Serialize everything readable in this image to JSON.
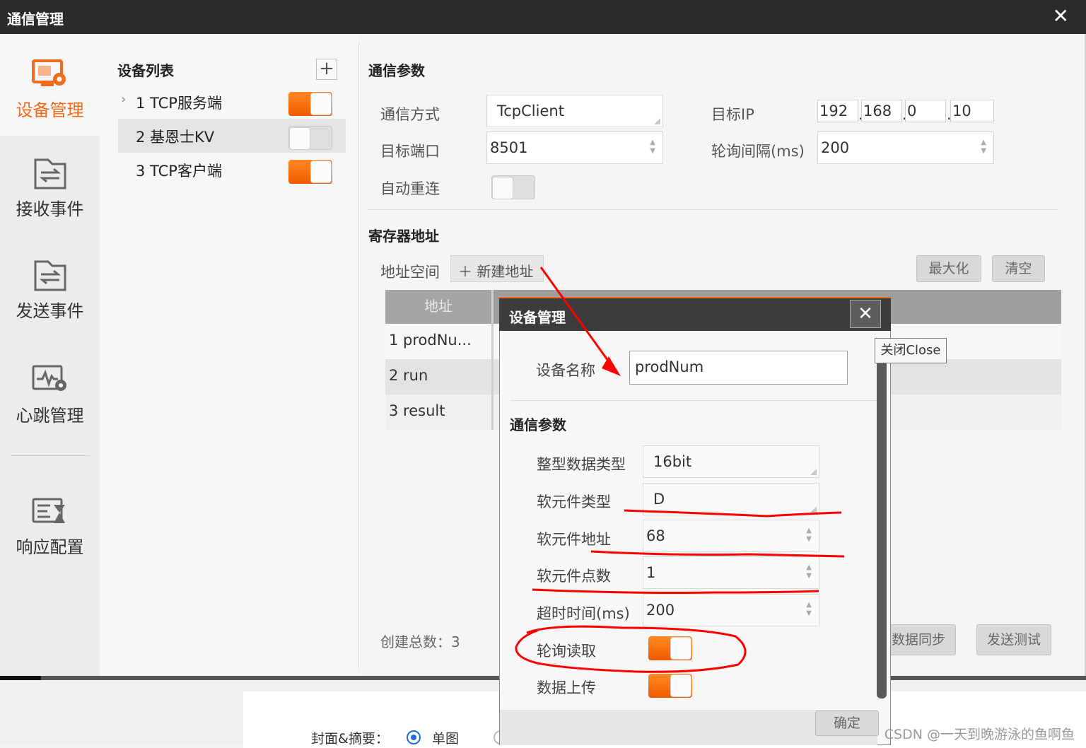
{
  "window": {
    "title": "通信管理",
    "close_glyph": "✕"
  },
  "sidebar": {
    "items": [
      {
        "label": "设备管理",
        "icon": "device-settings-icon",
        "active": true
      },
      {
        "label": "接收事件",
        "icon": "receive-event-icon"
      },
      {
        "label": "发送事件",
        "icon": "send-event-icon"
      },
      {
        "label": "心跳管理",
        "icon": "heartbeat-icon"
      },
      {
        "label": "响应配置",
        "icon": "response-config-icon"
      }
    ]
  },
  "devices": {
    "title": "设备列表",
    "add_glyph": "+",
    "items": [
      {
        "label": "1 TCP服务端",
        "enabled": true
      },
      {
        "label": "2 基恩士KV",
        "enabled": false,
        "selected": true
      },
      {
        "label": "3 TCP客户端",
        "enabled": true
      }
    ]
  },
  "comm": {
    "title": "通信参数",
    "mode_label": "通信方式",
    "mode_value": "TcpClient",
    "ip_label": "目标IP",
    "ip": [
      "192",
      "168",
      "0",
      "10"
    ],
    "port_label": "目标端口",
    "port_value": "8501",
    "poll_label": "轮询间隔(ms)",
    "poll_value": "200",
    "reconnect_label": "自动重连",
    "reconnect_on": false
  },
  "registers": {
    "title": "寄存器地址",
    "space_label": "地址空间",
    "add_label": "新建地址",
    "maximize_label": "最大化",
    "clear_label": "清空",
    "col_header": "地址",
    "rows": [
      "1 prodNu...",
      "2 run",
      "3 result"
    ],
    "created_label": "创建总数：3",
    "sync_label": "数据同步",
    "test_label": "发送测试"
  },
  "dialog": {
    "title": "设备管理",
    "close_glyph": "✕",
    "tooltip": "关闭Close",
    "name_label": "设备名称",
    "name_value": "prodNum",
    "section": "通信参数",
    "int_type_label": "整型数据类型",
    "int_type_value": "16bit",
    "elem_type_label": "软元件类型",
    "elem_type_value": "D",
    "elem_addr_label": "软元件地址",
    "elem_addr_value": "68",
    "elem_count_label": "软元件点数",
    "elem_count_value": "1",
    "timeout_label": "超时时间(ms)",
    "timeout_value": "200",
    "poll_read_label": "轮询读取",
    "poll_read_on": true,
    "upload_label": "数据上传",
    "upload_on": true,
    "ok_label": "确定"
  },
  "below": {
    "cover_label": "封面&摘要：",
    "option": "单图"
  },
  "watermark": "CSDN @一天到晚游泳的鱼啊鱼",
  "colors": {
    "accent": "#f16b1c",
    "titlebar": "#2b2b2b",
    "annotation": "#ff0000"
  }
}
